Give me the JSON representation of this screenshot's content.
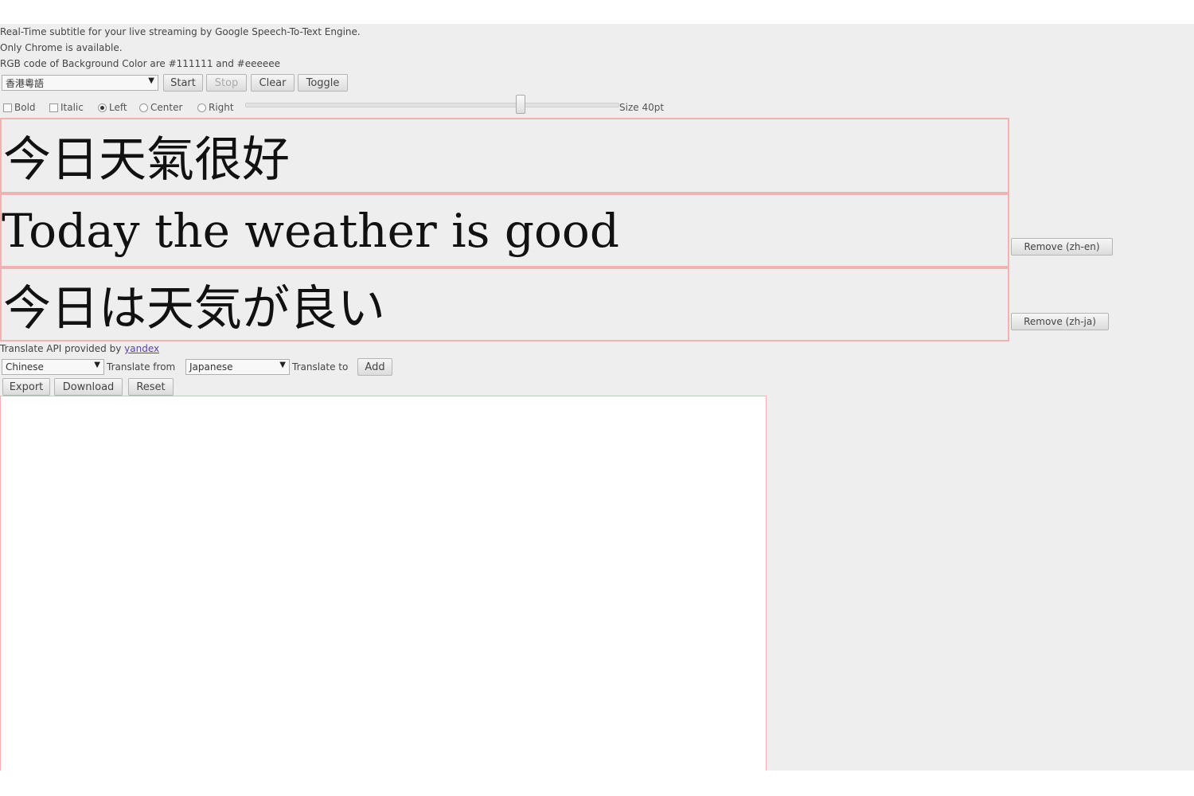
{
  "info": {
    "line1": "Real-Time subtitle for your live streaming by Google Speech-To-Text Engine.",
    "line2": "Only Chrome is available.",
    "line3": "RGB code of Background Color are #111111 and #eeeeee"
  },
  "controls": {
    "language_select": "香港粵語",
    "start": "Start",
    "stop": "Stop",
    "clear": "Clear",
    "toggle": "Toggle"
  },
  "format": {
    "bold": "Bold",
    "italic": "Italic",
    "left": "Left",
    "center": "Center",
    "right": "Right",
    "selected_alignment": "Left",
    "size_label": "Size 40pt",
    "slider_fraction": 0.74
  },
  "subtitles": {
    "original": "今日天氣很好",
    "english": "Today the weather is good",
    "japanese": "今日は天気が良い"
  },
  "remove_buttons": {
    "en": "Remove (zh-en)",
    "ja": "Remove (zh-ja)"
  },
  "translate": {
    "credit_text": "Translate API provided by ",
    "credit_link": "yandex",
    "from_select": "Chinese",
    "from_label": "Translate from",
    "to_select": "Japanese",
    "to_label": "Translate to",
    "add": "Add"
  },
  "actions": {
    "export": "Export",
    "download": "Download",
    "reset": "Reset"
  },
  "output_text": ""
}
